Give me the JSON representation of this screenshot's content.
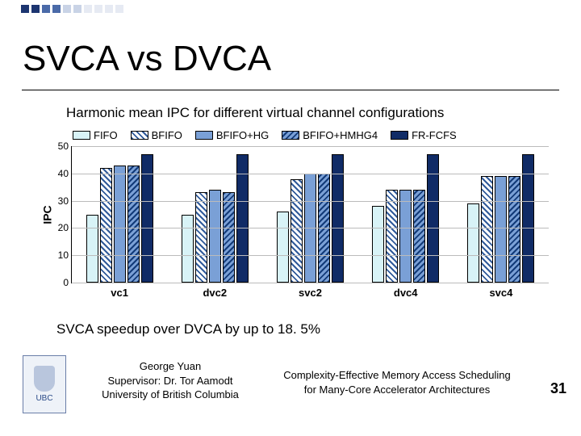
{
  "title": "SVCA vs DVCA",
  "subtitle": "Harmonic mean IPC for different virtual channel configurations",
  "conclusion": "SVCA speedup over DVCA by up to 18. 5%",
  "footer": {
    "author": "George Yuan",
    "supervisor": "Supervisor: Dr. Tor Aamodt",
    "institution": "University of British Columbia",
    "talk_title_a": "Complexity-Effective Memory Access Scheduling",
    "talk_title_b": "for Many-Core Accelerator Architectures",
    "page": "31",
    "logo_text": "UBC"
  },
  "chart_data": {
    "type": "bar",
    "ylabel": "IPC",
    "ylim": [
      0,
      50
    ],
    "yticks": [
      0,
      10,
      20,
      30,
      40,
      50
    ],
    "categories": [
      "vc1",
      "dvc2",
      "svc2",
      "dvc4",
      "svc4"
    ],
    "series": [
      {
        "name": "FIFO",
        "fill": "fill-fifo",
        "values": [
          25,
          25,
          26,
          28,
          29
        ]
      },
      {
        "name": "BFIFO",
        "fill": "fill-bfifo",
        "values": [
          42,
          33,
          38,
          34,
          39
        ]
      },
      {
        "name": "BFIFO+HG",
        "fill": "fill-bfifohg",
        "values": [
          43,
          34,
          40,
          34,
          39
        ]
      },
      {
        "name": "BFIFO+HMHG4",
        "fill": "fill-bfifohmhg4",
        "values": [
          43,
          33,
          40,
          34,
          39
        ]
      },
      {
        "name": "FR-FCFS",
        "fill": "fill-frfcfs",
        "values": [
          47,
          47,
          47,
          47,
          47
        ]
      }
    ]
  }
}
